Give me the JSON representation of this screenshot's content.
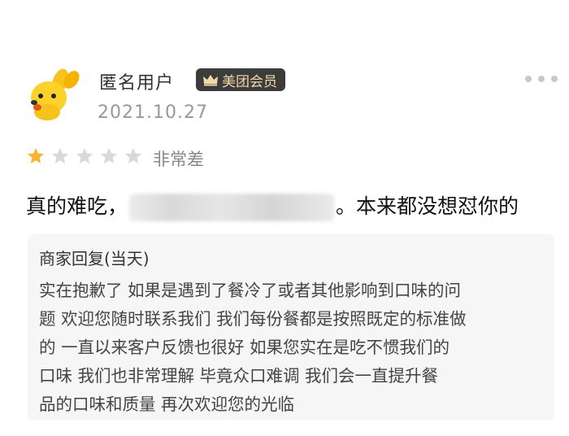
{
  "user": {
    "name": "匿名用户",
    "badge": "美团会员",
    "date": "2021.10.27",
    "avatar_icon": "yellow-dog-avatar-icon"
  },
  "rating": {
    "stars_filled": 1,
    "stars_total": 5,
    "label": "非常差",
    "filled_color": "#f6b52e",
    "empty_color": "#d9d9d9"
  },
  "review": {
    "text_before": "真的难吃，",
    "text_after": "。本来都没想怼你的"
  },
  "merchant_reply": {
    "title": "商家回复(当天)",
    "text": "实在抱歉了  如果是遇到了餐冷了或者其他影响到口味的问\n题  欢迎您随时联系我们  我们每份餐都是按照既定的标准做\n的  一直以来客户反馈也很好   如果您实在是吃不惯我们的\n口味  我们也非常理解      毕竟众口难调  我们会一直提升餐\n品的口味和质量  再次欢迎您的光临"
  },
  "colors": {
    "badge_bg": "#3c3c3c",
    "badge_text": "#f3d7a6",
    "reply_bg": "#f6f6f6"
  }
}
